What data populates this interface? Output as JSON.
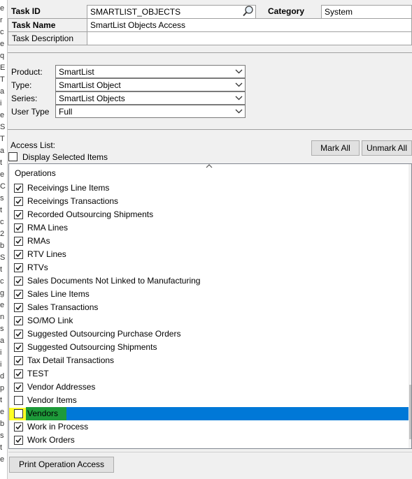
{
  "task": {
    "id_label": "Task ID",
    "id_value": "SMARTLIST_OBJECTS",
    "category_label": "Category",
    "category_value": "System",
    "name_label": "Task Name",
    "name_value": "SmartList Objects Access",
    "desc_label": "Task Description",
    "desc_value": ""
  },
  "filters": {
    "product": {
      "label": "Product:",
      "value": "SmartList"
    },
    "type": {
      "label": "Type:",
      "value": "SmartList Object"
    },
    "series": {
      "label": "Series:",
      "value": "SmartList Objects"
    },
    "user_type": {
      "label": "User Type",
      "value": "Full"
    }
  },
  "access": {
    "list_label": "Access List:",
    "display_selected_label": "Display Selected Items",
    "display_selected_checked": false,
    "mark_all_label": "Mark All",
    "unmark_all_label": "Unmark All",
    "header": "Operations",
    "items": [
      {
        "label": "Receivings Line Items",
        "checked": true,
        "selected": false
      },
      {
        "label": "Receivings Transactions",
        "checked": true,
        "selected": false
      },
      {
        "label": "Recorded Outsourcing Shipments",
        "checked": true,
        "selected": false
      },
      {
        "label": "RMA Lines",
        "checked": true,
        "selected": false
      },
      {
        "label": "RMAs",
        "checked": true,
        "selected": false
      },
      {
        "label": "RTV Lines",
        "checked": true,
        "selected": false
      },
      {
        "label": "RTVs",
        "checked": true,
        "selected": false
      },
      {
        "label": "Sales Documents Not Linked to Manufacturing",
        "checked": true,
        "selected": false
      },
      {
        "label": "Sales Line Items",
        "checked": true,
        "selected": false
      },
      {
        "label": "Sales Transactions",
        "checked": true,
        "selected": false
      },
      {
        "label": "SO/MO Link",
        "checked": true,
        "selected": false
      },
      {
        "label": "Suggested Outsourcing Purchase Orders",
        "checked": true,
        "selected": false
      },
      {
        "label": "Suggested Outsourcing Shipments",
        "checked": true,
        "selected": false
      },
      {
        "label": "Tax Detail Transactions",
        "checked": true,
        "selected": false
      },
      {
        "label": "TEST",
        "checked": true,
        "selected": false
      },
      {
        "label": "Vendor Addresses",
        "checked": true,
        "selected": false
      },
      {
        "label": "Vendor Items",
        "checked": false,
        "selected": false
      },
      {
        "label": "Vendors",
        "checked": false,
        "selected": true
      },
      {
        "label": "Work in Process",
        "checked": true,
        "selected": false
      },
      {
        "label": "Work Orders",
        "checked": true,
        "selected": false
      }
    ]
  },
  "print_button_label": "Print Operation Access",
  "left_strip_chars": [
    "e",
    "r",
    "c",
    "e",
    "q",
    "E",
    "T",
    "a",
    "i",
    "e",
    "S",
    "T",
    "a",
    "t",
    "e",
    "C",
    "s",
    "t",
    "c",
    "2",
    "b",
    "S",
    "t",
    "c",
    "g",
    "e",
    "n",
    "s",
    "a",
    "i",
    "i",
    "d",
    "p",
    "t",
    "e",
    "b",
    "s",
    "t",
    "e"
  ],
  "icons": {
    "lookup": "magnifier-icon",
    "dropdown": "chevron-down-icon",
    "scroll_up": "scroll-up-icon",
    "check": "checkmark-icon"
  },
  "colors": {
    "selection": "#0078d7",
    "highlight_marker": "#ffff00",
    "window": "#f0f0f0"
  }
}
